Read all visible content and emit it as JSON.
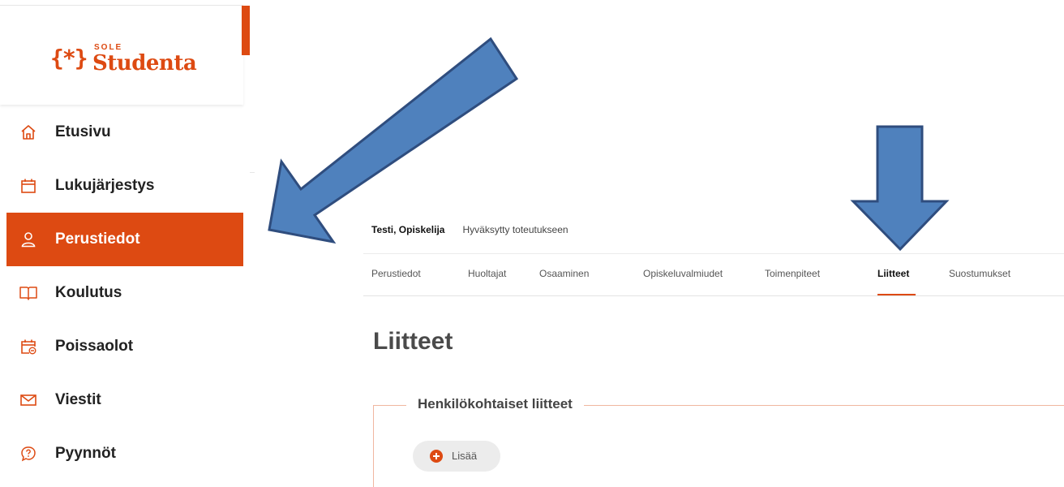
{
  "brand": {
    "sub": "SOLE",
    "name": "Studenta",
    "mark": "{*}",
    "accent_color": "#dd4a12"
  },
  "sidebar": {
    "items": [
      {
        "label": "Etusivu",
        "icon": "home-icon"
      },
      {
        "label": "Lukujärjestys",
        "icon": "calendar-icon"
      },
      {
        "label": "Perustiedot",
        "icon": "user-icon",
        "active": true
      },
      {
        "label": "Koulutus",
        "icon": "book-icon"
      },
      {
        "label": "Poissaolot",
        "icon": "calendar-absence-icon"
      },
      {
        "label": "Viestit",
        "icon": "mail-icon"
      },
      {
        "label": "Pyynnöt",
        "icon": "question-bubble-icon"
      }
    ]
  },
  "student": {
    "name": "Testi, Opiskelija",
    "status": "Hyväksytty toteutukseen"
  },
  "tabs": [
    {
      "label": "Perustiedot"
    },
    {
      "label": "Huoltajat"
    },
    {
      "label": "Osaaminen"
    },
    {
      "label": "Opiskeluvalmiudet"
    },
    {
      "label": "Toimenpiteet"
    },
    {
      "label": "Liitteet",
      "active": true
    },
    {
      "label": "Suostumukset"
    }
  ],
  "page": {
    "title": "Liitteet",
    "section_title": "Henkilökohtaiset liitteet",
    "add_label": "Lisää"
  },
  "annotations": {
    "arrow_color": "#4f81bd",
    "arrow_stroke": "#2f4d7e"
  }
}
